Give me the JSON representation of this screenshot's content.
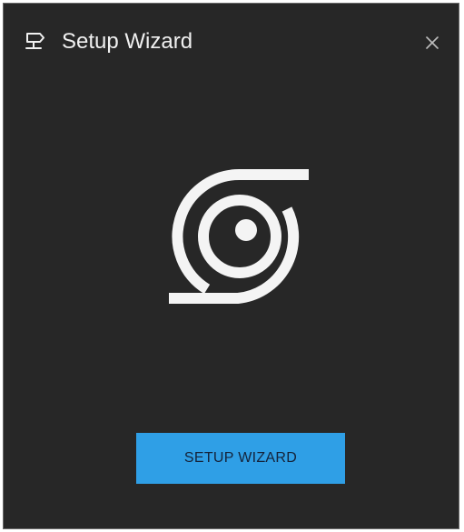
{
  "dialog": {
    "title": "Setup Wizard",
    "title_icon": "wizard-icon",
    "close_icon": "close-icon",
    "logo": "camera-lens-logo",
    "button_label": "SETUP WIZARD"
  },
  "colors": {
    "background": "#272727",
    "text": "#f0f0f0",
    "accent": "#2f9fe6",
    "button_text": "#15233a"
  }
}
